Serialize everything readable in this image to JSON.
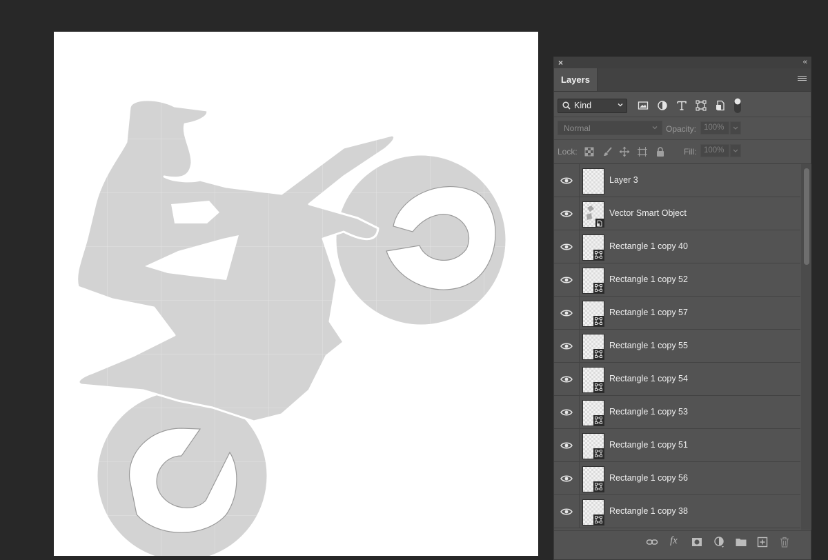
{
  "panel": {
    "close_glyph": "×",
    "collapse_glyph": "‹‹",
    "tab_label": "Layers",
    "filter": {
      "kind_label": "Kind",
      "icons": [
        "pixel-filter-icon",
        "adjustment-filter-icon",
        "type-filter-icon",
        "shape-filter-icon",
        "smart-object-filter-icon",
        "filter-toggle-icon"
      ]
    },
    "blend_mode": "Normal",
    "opacity_label": "Opacity:",
    "opacity_value": "100%",
    "lock_label": "Lock:",
    "lock_icons": [
      "lock-transparent-icon",
      "lock-image-icon",
      "lock-position-icon",
      "lock-artboard-icon",
      "lock-all-icon"
    ],
    "fill_label": "Fill:",
    "fill_value": "100%",
    "layers": [
      {
        "name": "Layer 3",
        "visible": true,
        "thumb": "pixel"
      },
      {
        "name": "Vector Smart Object",
        "visible": true,
        "thumb": "smart"
      },
      {
        "name": "Rectangle 1 copy 40",
        "visible": true,
        "thumb": "shape"
      },
      {
        "name": "Rectangle 1 copy 52",
        "visible": true,
        "thumb": "shape"
      },
      {
        "name": "Rectangle 1 copy 57",
        "visible": true,
        "thumb": "shape"
      },
      {
        "name": "Rectangle 1 copy 55",
        "visible": true,
        "thumb": "shape"
      },
      {
        "name": "Rectangle 1 copy 54",
        "visible": true,
        "thumb": "shape"
      },
      {
        "name": "Rectangle 1 copy 53",
        "visible": true,
        "thumb": "shape"
      },
      {
        "name": "Rectangle 1 copy 51",
        "visible": true,
        "thumb": "shape"
      },
      {
        "name": "Rectangle 1 copy 56",
        "visible": true,
        "thumb": "shape"
      },
      {
        "name": "Rectangle 1 copy 38",
        "visible": true,
        "thumb": "shape"
      }
    ],
    "bottom_icons": [
      "link-layers-icon",
      "fx-icon",
      "add-mask-icon",
      "adjustment-layer-icon",
      "new-group-icon",
      "new-layer-icon",
      "delete-layer-icon"
    ],
    "fx_glyph": "fx"
  },
  "colors": {
    "workspace": "#282828",
    "panel": "#535353",
    "silhouette": "#d3d3d3"
  }
}
